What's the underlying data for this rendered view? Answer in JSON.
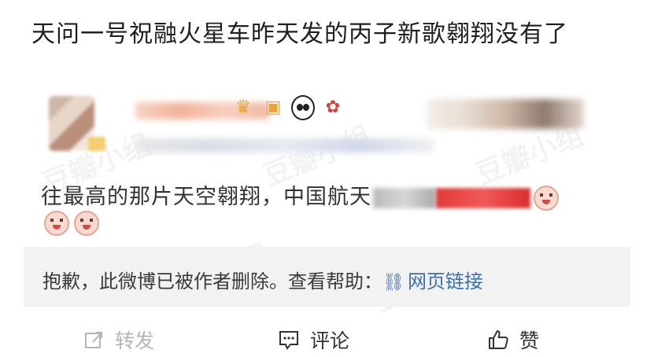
{
  "headline": "天问一号祝融火星车昨天发的丙子新歌翱翔没有了",
  "watermark": "豆瓣小组",
  "post": {
    "body_text": "往最高的那片天空翱翔，中国航天",
    "header_emojis": [
      "crown-emoji",
      "cake-emoji",
      "panda-emoji",
      "gift-emoji"
    ]
  },
  "deleted_notice": {
    "text": "抱歉，此微博已被作者删除。查看帮助：",
    "link_label": "网页链接"
  },
  "actions": {
    "repost_label": "转发",
    "comment_label": "评论",
    "like_label": "赞"
  },
  "colors": {
    "link": "#3b6fb3",
    "notice_bg": "#f2f2f2",
    "disabled": "#b5b5b5"
  }
}
